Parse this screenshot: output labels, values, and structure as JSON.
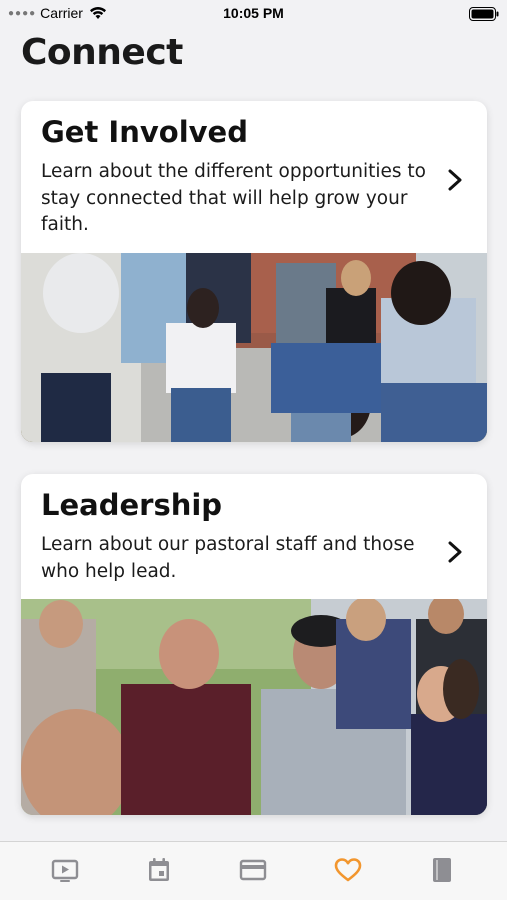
{
  "status_bar": {
    "carrier": "Carrier",
    "time": "10:05 PM"
  },
  "page": {
    "title": "Connect"
  },
  "cards": [
    {
      "title": "Get Involved",
      "description": "Learn about the different opportunities to stay connected that will help grow your faith.",
      "icon": "chevron-right-icon",
      "image": "group-sitting-on-steps-photo"
    },
    {
      "title": "Leadership",
      "description": "Learn about our pastoral staff and those who help lead.",
      "icon": "chevron-right-icon",
      "image": "pastoral-staff-group-photo"
    }
  ],
  "tab_bar": {
    "items": [
      {
        "icon": "video-icon",
        "active": false
      },
      {
        "icon": "calendar-icon",
        "active": false
      },
      {
        "icon": "card-icon",
        "active": false
      },
      {
        "icon": "heart-icon",
        "active": true
      },
      {
        "icon": "book-icon",
        "active": false
      }
    ],
    "active_color": "#f2962e",
    "inactive_color": "#8e8e93"
  }
}
